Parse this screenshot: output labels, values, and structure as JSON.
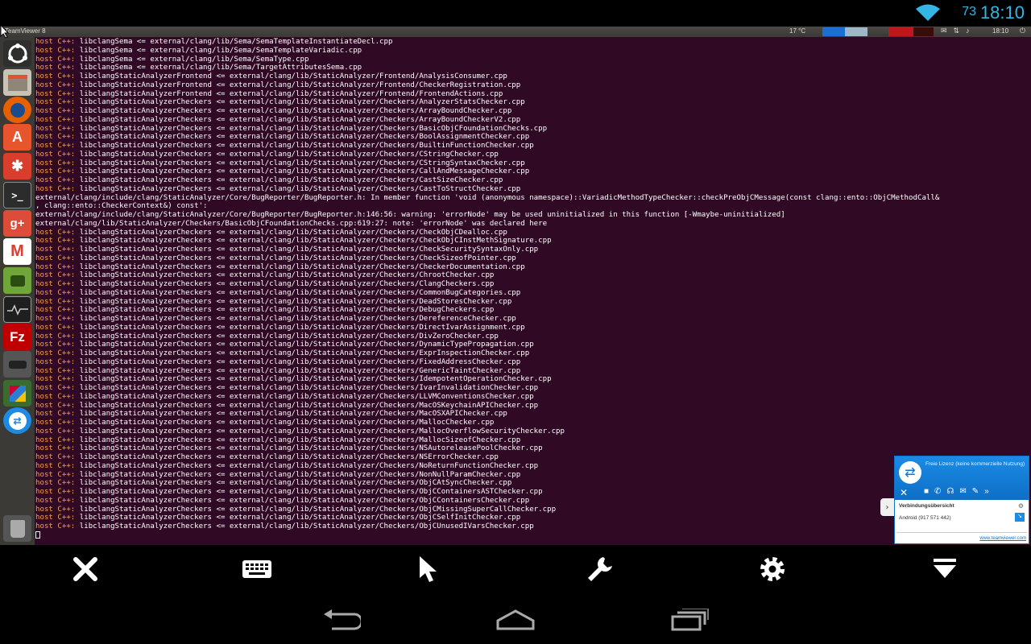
{
  "android": {
    "battery_level": "73",
    "clock": "18:10"
  },
  "panel": {
    "title": "TeamViewer 8",
    "weather": "17 °C",
    "time": "18:10"
  },
  "terminal": {
    "lines": [
      {
        "p": "host C++: ",
        "t": "libclangSema <= external/clang/lib/Sema/SemaTemplateInstantiateDecl.cpp"
      },
      {
        "p": "host C++: ",
        "t": "libclangSema <= external/clang/lib/Sema/SemaTemplateVariadic.cpp"
      },
      {
        "p": "host C++: ",
        "t": "libclangSema <= external/clang/lib/Sema/SemaType.cpp"
      },
      {
        "p": "host C++: ",
        "t": "libclangSema <= external/clang/lib/Sema/TargetAttributesSema.cpp"
      },
      {
        "p": "host C++: ",
        "t": "libclangStaticAnalyzerFrontend <= external/clang/lib/StaticAnalyzer/Frontend/AnalysisConsumer.cpp"
      },
      {
        "p": "host C++: ",
        "t": "libclangStaticAnalyzerFrontend <= external/clang/lib/StaticAnalyzer/Frontend/CheckerRegistration.cpp"
      },
      {
        "p": "host C++: ",
        "t": "libclangStaticAnalyzerFrontend <= external/clang/lib/StaticAnalyzer/Frontend/FrontendActions.cpp"
      },
      {
        "p": "host C++: ",
        "t": "libclangStaticAnalyzerCheckers <= external/clang/lib/StaticAnalyzer/Checkers/AnalyzerStatsChecker.cpp"
      },
      {
        "p": "host C++: ",
        "t": "libclangStaticAnalyzerCheckers <= external/clang/lib/StaticAnalyzer/Checkers/ArrayBoundChecker.cpp"
      },
      {
        "p": "host C++: ",
        "t": "libclangStaticAnalyzerCheckers <= external/clang/lib/StaticAnalyzer/Checkers/ArrayBoundCheckerV2.cpp"
      },
      {
        "p": "host C++: ",
        "t": "libclangStaticAnalyzerCheckers <= external/clang/lib/StaticAnalyzer/Checkers/BasicObjCFoundationChecks.cpp"
      },
      {
        "p": "host C++: ",
        "t": "libclangStaticAnalyzerCheckers <= external/clang/lib/StaticAnalyzer/Checkers/BoolAssignmentChecker.cpp"
      },
      {
        "p": "host C++: ",
        "t": "libclangStaticAnalyzerCheckers <= external/clang/lib/StaticAnalyzer/Checkers/BuiltinFunctionChecker.cpp"
      },
      {
        "p": "host C++: ",
        "t": "libclangStaticAnalyzerCheckers <= external/clang/lib/StaticAnalyzer/Checkers/CStringChecker.cpp"
      },
      {
        "p": "host C++: ",
        "t": "libclangStaticAnalyzerCheckers <= external/clang/lib/StaticAnalyzer/Checkers/CStringSyntaxChecker.cpp"
      },
      {
        "p": "host C++: ",
        "t": "libclangStaticAnalyzerCheckers <= external/clang/lib/StaticAnalyzer/Checkers/CallAndMessageChecker.cpp"
      },
      {
        "p": "host C++: ",
        "t": "libclangStaticAnalyzerCheckers <= external/clang/lib/StaticAnalyzer/Checkers/CastSizeChecker.cpp"
      },
      {
        "p": "host C++: ",
        "t": "libclangStaticAnalyzerCheckers <= external/clang/lib/StaticAnalyzer/Checkers/CastToStructChecker.cpp"
      },
      {
        "p": "",
        "t": "external/clang/include/clang/StaticAnalyzer/Core/BugReporter/BugReporter.h: In member function 'void (anonymous namespace)::VariadicMethodTypeChecker::checkPreObjCMessage(const clang::ento::ObjCMethodCall&"
      },
      {
        "p": "",
        "t": ", clang::ento::CheckerContext&) const':"
      },
      {
        "p": "",
        "t": "external/clang/include/clang/StaticAnalyzer/Core/BugReporter/BugReporter.h:146:56: warning: 'errorNode' may be used uninitialized in this function [-Wmaybe-uninitialized]"
      },
      {
        "p": "",
        "t": "external/clang/lib/StaticAnalyzer/Checkers/BasicObjCFoundationChecks.cpp:619:27: note: 'errorNode' was declared here"
      },
      {
        "p": "host C++: ",
        "t": "libclangStaticAnalyzerCheckers <= external/clang/lib/StaticAnalyzer/Checkers/CheckObjCDealloc.cpp"
      },
      {
        "p": "host C++: ",
        "t": "libclangStaticAnalyzerCheckers <= external/clang/lib/StaticAnalyzer/Checkers/CheckObjCInstMethSignature.cpp"
      },
      {
        "p": "host C++: ",
        "t": "libclangStaticAnalyzerCheckers <= external/clang/lib/StaticAnalyzer/Checkers/CheckSecuritySyntaxOnly.cpp"
      },
      {
        "p": "host C++: ",
        "t": "libclangStaticAnalyzerCheckers <= external/clang/lib/StaticAnalyzer/Checkers/CheckSizeofPointer.cpp"
      },
      {
        "p": "host C++: ",
        "t": "libclangStaticAnalyzerCheckers <= external/clang/lib/StaticAnalyzer/Checkers/CheckerDocumentation.cpp"
      },
      {
        "p": "host C++: ",
        "t": "libclangStaticAnalyzerCheckers <= external/clang/lib/StaticAnalyzer/Checkers/ChrootChecker.cpp"
      },
      {
        "p": "host C++: ",
        "t": "libclangStaticAnalyzerCheckers <= external/clang/lib/StaticAnalyzer/Checkers/ClangCheckers.cpp"
      },
      {
        "p": "host C++: ",
        "t": "libclangStaticAnalyzerCheckers <= external/clang/lib/StaticAnalyzer/Checkers/CommonBugCategories.cpp"
      },
      {
        "p": "host C++: ",
        "t": "libclangStaticAnalyzerCheckers <= external/clang/lib/StaticAnalyzer/Checkers/DeadStoresChecker.cpp"
      },
      {
        "p": "host C++: ",
        "t": "libclangStaticAnalyzerCheckers <= external/clang/lib/StaticAnalyzer/Checkers/DebugCheckers.cpp"
      },
      {
        "p": "host C++: ",
        "t": "libclangStaticAnalyzerCheckers <= external/clang/lib/StaticAnalyzer/Checkers/DereferenceChecker.cpp"
      },
      {
        "p": "host C++: ",
        "t": "libclangStaticAnalyzerCheckers <= external/clang/lib/StaticAnalyzer/Checkers/DirectIvarAssignment.cpp"
      },
      {
        "p": "host C++: ",
        "t": "libclangStaticAnalyzerCheckers <= external/clang/lib/StaticAnalyzer/Checkers/DivZeroChecker.cpp"
      },
      {
        "p": "host C++: ",
        "t": "libclangStaticAnalyzerCheckers <= external/clang/lib/StaticAnalyzer/Checkers/DynamicTypePropagation.cpp"
      },
      {
        "p": "host C++: ",
        "t": "libclangStaticAnalyzerCheckers <= external/clang/lib/StaticAnalyzer/Checkers/ExprInspectionChecker.cpp"
      },
      {
        "p": "host C++: ",
        "t": "libclangStaticAnalyzerCheckers <= external/clang/lib/StaticAnalyzer/Checkers/FixedAddressChecker.cpp"
      },
      {
        "p": "host C++: ",
        "t": "libclangStaticAnalyzerCheckers <= external/clang/lib/StaticAnalyzer/Checkers/GenericTaintChecker.cpp"
      },
      {
        "p": "host C++: ",
        "t": "libclangStaticAnalyzerCheckers <= external/clang/lib/StaticAnalyzer/Checkers/IdempotentOperationChecker.cpp"
      },
      {
        "p": "host C++: ",
        "t": "libclangStaticAnalyzerCheckers <= external/clang/lib/StaticAnalyzer/Checkers/IvarInvalidationChecker.cpp"
      },
      {
        "p": "host C++: ",
        "t": "libclangStaticAnalyzerCheckers <= external/clang/lib/StaticAnalyzer/Checkers/LLVMConventionsChecker.cpp"
      },
      {
        "p": "host C++: ",
        "t": "libclangStaticAnalyzerCheckers <= external/clang/lib/StaticAnalyzer/Checkers/MacOSKeychainAPIChecker.cpp"
      },
      {
        "p": "host C++: ",
        "t": "libclangStaticAnalyzerCheckers <= external/clang/lib/StaticAnalyzer/Checkers/MacOSXAPIChecker.cpp"
      },
      {
        "p": "host C++: ",
        "t": "libclangStaticAnalyzerCheckers <= external/clang/lib/StaticAnalyzer/Checkers/MallocChecker.cpp"
      },
      {
        "p": "host C++: ",
        "t": "libclangStaticAnalyzerCheckers <= external/clang/lib/StaticAnalyzer/Checkers/MallocOverflowSecurityChecker.cpp"
      },
      {
        "p": "host C++: ",
        "t": "libclangStaticAnalyzerCheckers <= external/clang/lib/StaticAnalyzer/Checkers/MallocSizeofChecker.cpp"
      },
      {
        "p": "host C++: ",
        "t": "libclangStaticAnalyzerCheckers <= external/clang/lib/StaticAnalyzer/Checkers/NSAutoreleasePoolChecker.cpp"
      },
      {
        "p": "host C++: ",
        "t": "libclangStaticAnalyzerCheckers <= external/clang/lib/StaticAnalyzer/Checkers/NSErrorChecker.cpp"
      },
      {
        "p": "host C++: ",
        "t": "libclangStaticAnalyzerCheckers <= external/clang/lib/StaticAnalyzer/Checkers/NoReturnFunctionChecker.cpp"
      },
      {
        "p": "host C++: ",
        "t": "libclangStaticAnalyzerCheckers <= external/clang/lib/StaticAnalyzer/Checkers/NonNullParamChecker.cpp"
      },
      {
        "p": "host C++: ",
        "t": "libclangStaticAnalyzerCheckers <= external/clang/lib/StaticAnalyzer/Checkers/ObjCAtSyncChecker.cpp"
      },
      {
        "p": "host C++: ",
        "t": "libclangStaticAnalyzerCheckers <= external/clang/lib/StaticAnalyzer/Checkers/ObjCContainersASTChecker.cpp"
      },
      {
        "p": "host C++: ",
        "t": "libclangStaticAnalyzerCheckers <= external/clang/lib/StaticAnalyzer/Checkers/ObjCContainersChecker.cpp"
      },
      {
        "p": "host C++: ",
        "t": "libclangStaticAnalyzerCheckers <= external/clang/lib/StaticAnalyzer/Checkers/ObjCMissingSuperCallChecker.cpp"
      },
      {
        "p": "host C++: ",
        "t": "libclangStaticAnalyzerCheckers <= external/clang/lib/StaticAnalyzer/Checkers/ObjCSelfInitChecker.cpp"
      },
      {
        "p": "host C++: ",
        "t": "libclangStaticAnalyzerCheckers <= external/clang/lib/StaticAnalyzer/Checkers/ObjCUnusedIVarsChecker.cpp"
      }
    ]
  },
  "teamviewer": {
    "license_text": "Freie Lizenz (keine kommerzielle Nutzung)",
    "overview_label": "Verbindungsübersicht",
    "session_label": "Android (917 571 442)",
    "website": "www.teamviewer.com"
  },
  "colors": {
    "terminal_bg": "#300a24",
    "host_prefix": "#f9a050",
    "accent": "#33b5e5",
    "teamviewer_blue": "#0e73cc"
  },
  "icons": {
    "toolbar": [
      "close-icon",
      "keyboard-icon",
      "pointer-icon",
      "wrench-icon",
      "gear-icon",
      "collapse-icon"
    ],
    "nav": [
      "back-icon",
      "home-icon",
      "recent-apps-icon"
    ]
  }
}
